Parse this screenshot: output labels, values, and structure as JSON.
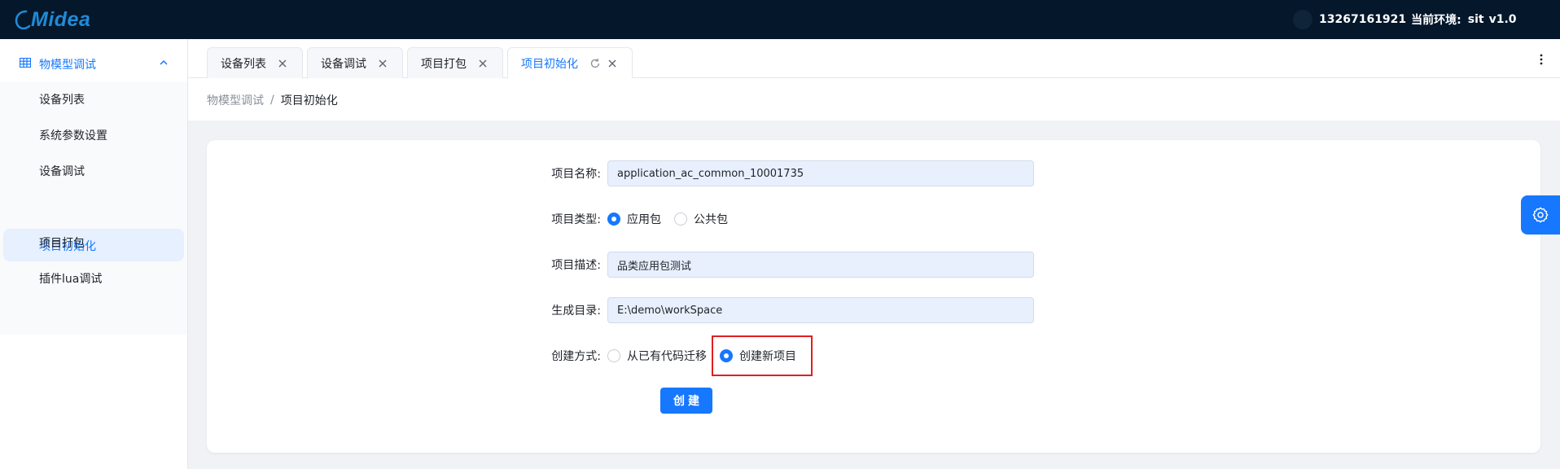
{
  "header": {
    "logo_text": "Midea",
    "phone": "13267161921",
    "env_label": "当前环境:",
    "env_value": "sit",
    "version": "v1.0"
  },
  "sidebar": {
    "group_label": "物模型调试",
    "items": [
      {
        "label": "设备列表"
      },
      {
        "label": "系统参数设置"
      },
      {
        "label": "设备调试"
      },
      {
        "label": "项目初始化"
      },
      {
        "label": "项目打包"
      },
      {
        "label": "插件lua调试"
      }
    ]
  },
  "tabs": [
    {
      "label": "设备列表"
    },
    {
      "label": "设备调试"
    },
    {
      "label": "项目打包"
    },
    {
      "label": "项目初始化"
    }
  ],
  "breadcrumb": {
    "parent": "物模型调试",
    "separator": "/",
    "current": "项目初始化"
  },
  "form": {
    "project_name_label": "项目名称:",
    "project_name_value": "application_ac_common_10001735",
    "project_type_label": "项目类型:",
    "type_option_app": "应用包",
    "type_option_common": "公共包",
    "description_label": "项目描述:",
    "description_value": "品类应用包测试",
    "output_dir_label": "生成目录:",
    "output_dir_value": "E:\\demo\\workSpace",
    "create_mode_label": "创建方式:",
    "mode_option_migrate": "从已有代码迁移",
    "mode_option_new": "创建新项目",
    "create_button": "创建"
  },
  "colors": {
    "accent": "#1677ff",
    "header_bg": "#04172b",
    "highlight": "#e02020"
  }
}
